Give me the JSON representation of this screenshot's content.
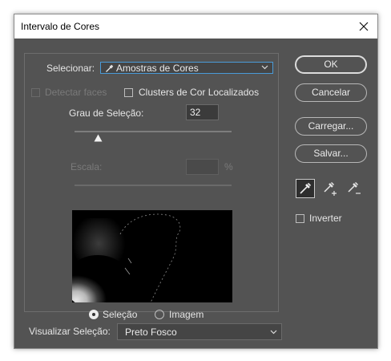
{
  "window": {
    "title": "Intervalo de Cores"
  },
  "selecionar": {
    "label": "Selecionar:",
    "value": "Amostras de Cores"
  },
  "options": {
    "detect_faces": "Detectar faces",
    "detect_faces_checked": false,
    "clusters": "Clusters de Cor Localizados",
    "clusters_checked": false
  },
  "fuzziness": {
    "label": "Grau de Seleção:",
    "value": "32",
    "slider_fraction": 0.16
  },
  "range": {
    "label": "Escala:",
    "value": "",
    "unit": "%"
  },
  "view": {
    "selection_label": "Seleção",
    "image_label": "Imagem",
    "selected": "Seleção"
  },
  "preview_mode": {
    "label": "Visualizar Seleção:",
    "value": "Preto Fosco"
  },
  "buttons": {
    "ok": "OK",
    "cancel": "Cancelar",
    "load": "Carregar...",
    "save": "Salvar..."
  },
  "tools": [
    "eyedropper-icon",
    "eyedropper-plus-icon",
    "eyedropper-minus-icon"
  ],
  "invert": {
    "label": "Inverter",
    "checked": false
  },
  "colors": {
    "dialog_bg": "#535353",
    "focus_border": "#4a9bd8",
    "preview_bg": "#000000"
  }
}
